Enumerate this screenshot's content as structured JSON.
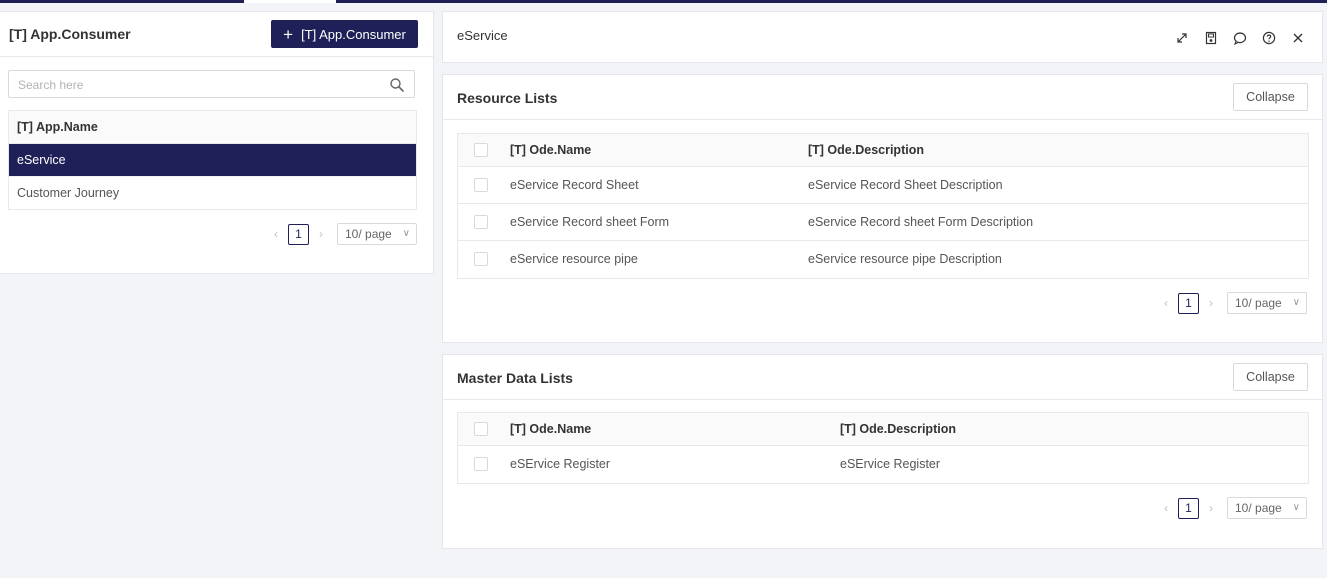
{
  "left_panel": {
    "title": "[T] App.Consumer",
    "add_button_label": "[T] App.Consumer",
    "search_placeholder": "Search here",
    "table_header": "[T] App.Name",
    "apps": [
      "eService",
      "Customer Journey"
    ],
    "selected_app": "eService",
    "pagination": {
      "current_page": "1",
      "page_size": "10/ page"
    }
  },
  "right_header": {
    "title": "eService",
    "icons": [
      "expand-icon",
      "save-icon",
      "comment-icon",
      "help-icon",
      "close-icon"
    ]
  },
  "resource_lists": {
    "title": "Resource Lists",
    "collapse_label": "Collapse",
    "columns": [
      "[T] Ode.Name",
      "[T] Ode.Description"
    ],
    "rows": [
      {
        "name": "eService Record Sheet",
        "description": "eService Record Sheet Description"
      },
      {
        "name": "eService Record sheet Form",
        "description": "eService Record sheet Form Description"
      },
      {
        "name": "eService resource pipe",
        "description": "eService resource pipe Description"
      }
    ],
    "pagination": {
      "current_page": "1",
      "page_size": "10/ page"
    }
  },
  "master_data_lists": {
    "title": "Master Data Lists",
    "collapse_label": "Collapse",
    "columns": [
      "[T] Ode.Name",
      "[T] Ode.Description"
    ],
    "rows": [
      {
        "name": "eSErvice Register",
        "description": "eSErvice Register"
      }
    ],
    "pagination": {
      "current_page": "1",
      "page_size": "10/ page"
    }
  },
  "colors": {
    "primary": "#1e2057",
    "background": "#f3f4f7"
  }
}
